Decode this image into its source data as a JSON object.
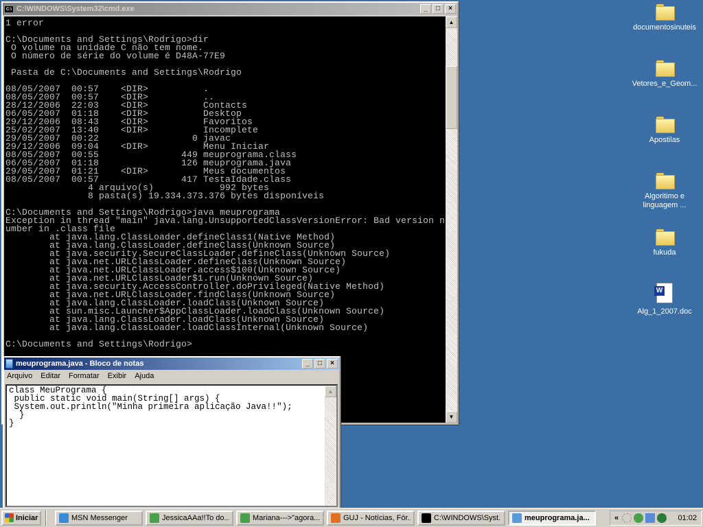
{
  "cmd": {
    "title": "C:\\WINDOWS\\System32\\cmd.exe",
    "icon_label": "C:\\",
    "lines": [
      "1 error",
      "",
      "C:\\Documents and Settings\\Rodrigo>dir",
      " O volume na unidade C não tem nome.",
      " O número de série do volume é D48A-77E9",
      "",
      " Pasta de C:\\Documents and Settings\\Rodrigo",
      "",
      "08/05/2007  00:57    <DIR>          .",
      "08/05/2007  00:57    <DIR>          ..",
      "28/12/2006  22:03    <DIR>          Contacts",
      "06/05/2007  01:18    <DIR>          Desktop",
      "29/12/2006  08:43    <DIR>          Favoritos",
      "25/02/2007  13:40    <DIR>          Incomplete",
      "29/05/2007  00:22                 0 javac",
      "29/12/2006  09:04    <DIR>          Menu Iniciar",
      "08/05/2007  00:55               449 meuprograma.class",
      "06/05/2007  01:18               126 meuprograma.java",
      "29/05/2007  01:21    <DIR>          Meus documentos",
      "08/05/2007  00:57               417 TestaIdade.class",
      "               4 arquivo(s)            992 bytes",
      "               8 pasta(s) 19.334.373.376 bytes disponíveis",
      "",
      "C:\\Documents and Settings\\Rodrigo>java meuprograma",
      "Exception in thread \"main\" java.lang.UnsupportedClassVersionError: Bad version n",
      "umber in .class file",
      "        at java.lang.ClassLoader.defineClass1(Native Method)",
      "        at java.lang.ClassLoader.defineClass(Unknown Source)",
      "        at java.security.SecureClassLoader.defineClass(Unknown Source)",
      "        at java.net.URLClassLoader.defineClass(Unknown Source)",
      "        at java.net.URLClassLoader.access$100(Unknown Source)",
      "        at java.net.URLClassLoader$1.run(Unknown Source)",
      "        at java.security.AccessController.doPrivileged(Native Method)",
      "        at java.net.URLClassLoader.findClass(Unknown Source)",
      "        at java.lang.ClassLoader.loadClass(Unknown Source)",
      "        at sun.misc.Launcher$AppClassLoader.loadClass(Unknown Source)",
      "        at java.lang.ClassLoader.loadClass(Unknown Source)",
      "        at java.lang.ClassLoader.loadClassInternal(Unknown Source)",
      "",
      "C:\\Documents and Settings\\Rodrigo>"
    ]
  },
  "notepad": {
    "title": "meuprograma.java - Bloco de notas",
    "menu": [
      "Arquivo",
      "Editar",
      "Formatar",
      "Exibir",
      "Ajuda"
    ],
    "lines": [
      "class MeuPrograma {",
      " public static void main(String[] args) {",
      " System.out.println(\"Minha primeira aplicação Java!!\");",
      "  }",
      "}"
    ]
  },
  "window_controls": {
    "minimize": "_",
    "maximize": "□",
    "close": "×"
  },
  "desktop_icons": [
    {
      "label": "documentosinuteis",
      "type": "folder"
    },
    {
      "label": "Vetores_e_Geom...",
      "type": "folder"
    },
    {
      "label": "Apostilas",
      "type": "folder"
    },
    {
      "label": "Algoritimo e linguagem ...",
      "type": "folder"
    },
    {
      "label": "fukuda",
      "type": "folder"
    },
    {
      "label": "Alg_1_2007.doc",
      "type": "word-doc"
    }
  ],
  "taskbar": {
    "start_label": "Iniciar",
    "buttons": [
      {
        "label": "MSN Messenger",
        "icon": "msn-icon",
        "color": "#3a8ad6"
      },
      {
        "label": "JessicaAAa!!To do...",
        "icon": "msn-chat-icon",
        "color": "#4aa04a"
      },
      {
        "label": "Mariana--->\"agora...",
        "icon": "msn-chat-icon",
        "color": "#4aa04a"
      },
      {
        "label": "GUJ - Notícias, Fór...",
        "icon": "firefox-icon",
        "color": "#e07020"
      },
      {
        "label": "C:\\WINDOWS\\Syst...",
        "icon": "cmd-icon",
        "color": "#000000"
      },
      {
        "label": "meuprograma.ja...",
        "icon": "notepad-icon",
        "color": "#5a9ad8",
        "active": true
      }
    ],
    "tray_expand": "«",
    "clock": "01:02"
  },
  "colors": {
    "desktop": "#3a6ea5",
    "active_title": "#0a246a",
    "console_text": "#c0c0c0"
  }
}
